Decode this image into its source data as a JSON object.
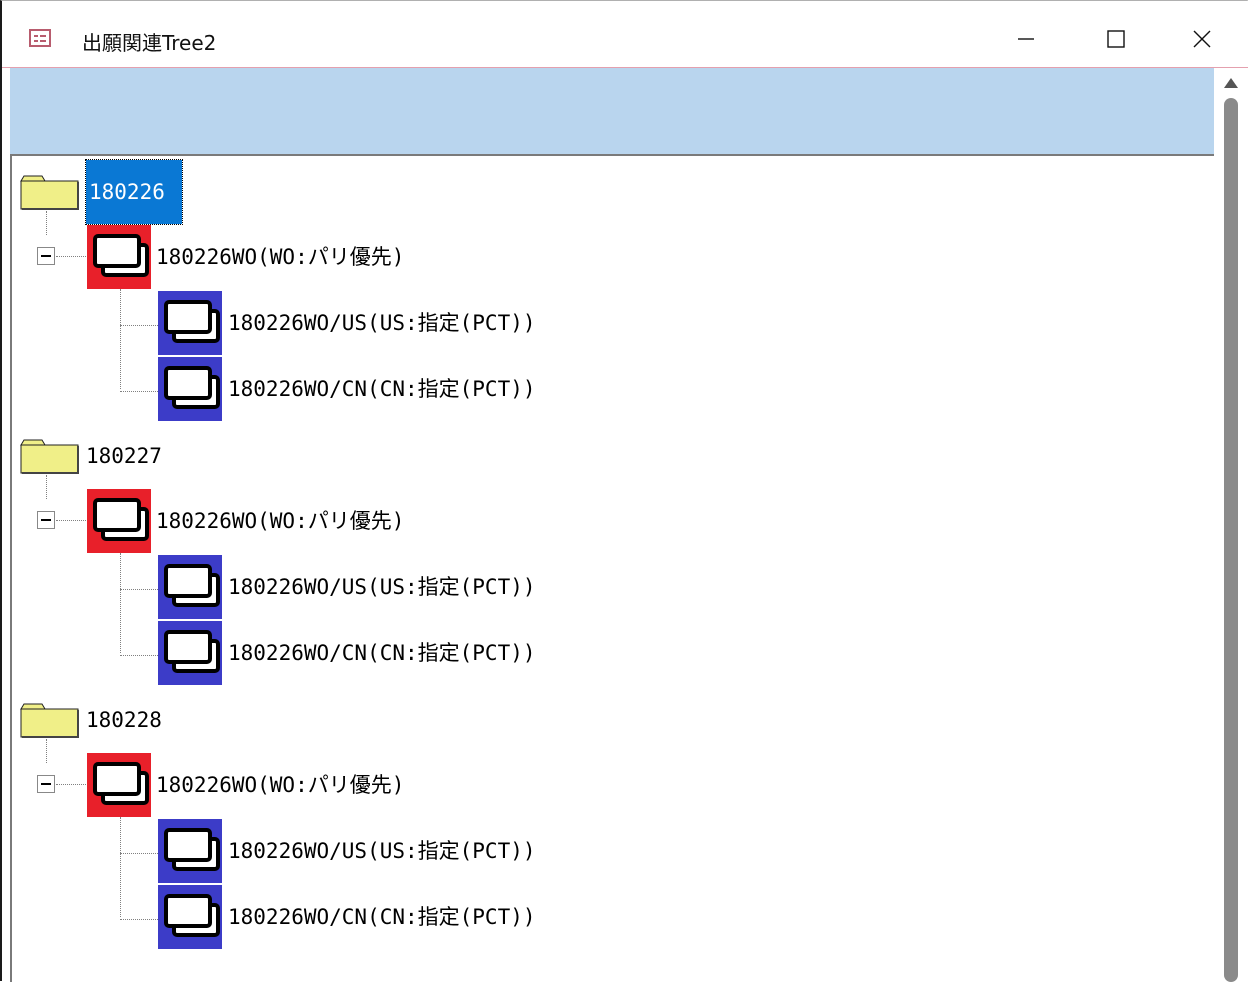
{
  "window": {
    "title": "出願関連Tree2",
    "minimize_icon": "minimize-icon",
    "maximize_icon": "maximize-icon",
    "close_icon": "close-icon"
  },
  "tree": [
    {
      "label": "180226",
      "selected": true,
      "children": [
        {
          "label": "180226WO(WO:パリ優先)",
          "children": [
            {
              "label": "180226WO/US(US:指定(PCT))"
            },
            {
              "label": "180226WO/CN(CN:指定(PCT))"
            }
          ]
        }
      ]
    },
    {
      "label": "180227",
      "selected": false,
      "children": [
        {
          "label": "180226WO(WO:パリ優先)",
          "children": [
            {
              "label": "180226WO/US(US:指定(PCT))"
            },
            {
              "label": "180226WO/CN(CN:指定(PCT))"
            }
          ]
        }
      ]
    },
    {
      "label": "180228",
      "selected": false,
      "children": [
        {
          "label": "180226WO(WO:パリ優先)",
          "children": [
            {
              "label": "180226WO/US(US:指定(PCT))"
            },
            {
              "label": "180226WO/CN(CN:指定(PCT))"
            }
          ]
        }
      ]
    }
  ],
  "colors": {
    "selection": "#0a78d4",
    "parent_node_bg": "#e8202a",
    "child_node_bg": "#3c3cc8",
    "folder_fill": "#f0ef88",
    "header_band": "#b9d5ee"
  }
}
